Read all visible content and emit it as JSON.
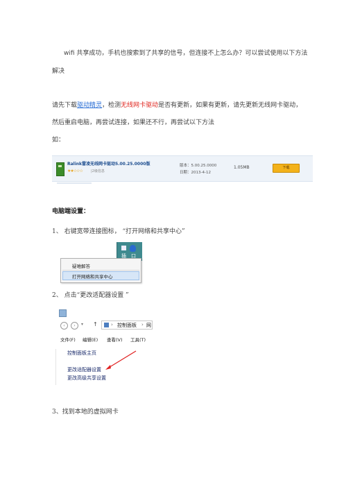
{
  "intro": {
    "line1": "wifi 共享成功，手机也搜索到了共享的信号，但连接不上怎么办？可以尝试使用以下方法",
    "line2": "解决"
  },
  "update_para": {
    "prefix": "请先下载",
    "link_driver_wizard": "驱动精灵",
    "mid1": "，检测",
    "highlight_wireless_driver": "无线网卡驱动",
    "rest_line1": "是否有更新，如果有更新，请先更新无线网卡驱动，",
    "line2": "然后重启电脑，再尝试连接，如果还不行，再尝试以下方法",
    "line3": "如："
  },
  "driver_strip": {
    "name": "Ralink雷凌无线网卡驱动5.00.25.0000版",
    "stars": "★★☆☆☆",
    "rating": "|2级信息",
    "version": "版本：5.00.25.0000",
    "date": "日期：2013-4-12",
    "size": "1.05MB",
    "download": "下载"
  },
  "pc_section": {
    "heading": "电脑端设置：",
    "step1": "1、   右键宽带连接图标， “打开网络和共享中心”",
    "step2": "2、 点击“更改适配器设置 ”",
    "step3": "3、找到本地的虚拟网卡"
  },
  "context_menu": {
    "taskbar_char1": "插",
    "taskbar_char2": "口",
    "item1": "疑难解答",
    "item2": "打开网络和共享中心"
  },
  "control_panel": {
    "address": "控制面板",
    "address_end": "网",
    "menubar": [
      "文件(F)",
      "编辑(E)",
      "查看(V)",
      "工具(T)"
    ],
    "link_home": "控制面板主页",
    "link_adapter": "更改适配器设置",
    "link_sharing": "更改高级共享设置"
  },
  "colors": {
    "highlight_red": "#e0261f",
    "link_blue": "#2b6fd6",
    "download_orange": "#f3b21b",
    "arrow_red": "#e02020"
  }
}
